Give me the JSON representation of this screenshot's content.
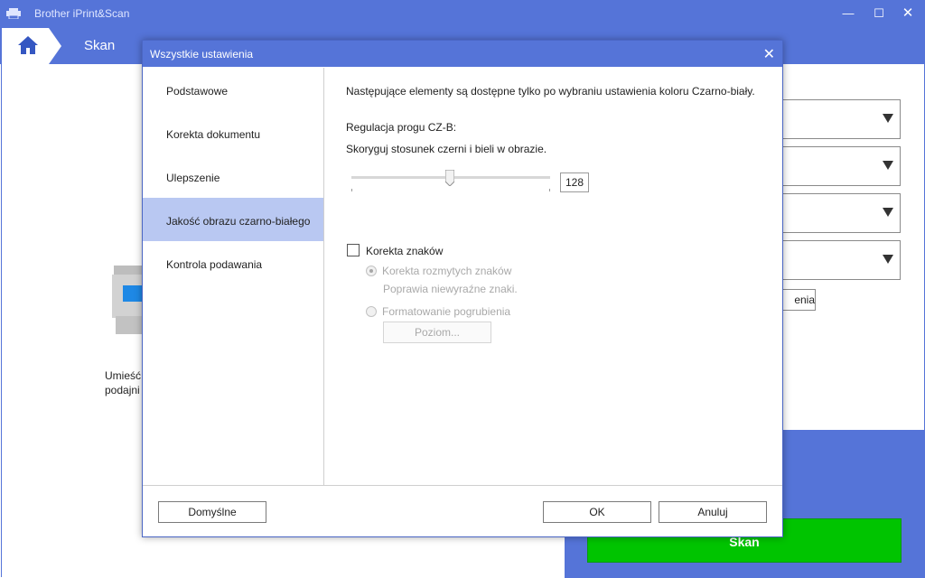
{
  "app": {
    "title": "Brother iPrint&Scan",
    "nav_title": "Skan"
  },
  "background": {
    "hint_line1": "Umieść",
    "hint_line2": "podajni",
    "settings_button_partial": "enia",
    "scan_button": "Skan"
  },
  "dialog": {
    "title": "Wszystkie ustawienia",
    "nav_items": [
      {
        "label": "Podstawowe"
      },
      {
        "label": "Korekta dokumentu"
      },
      {
        "label": "Ulepszenie"
      },
      {
        "label": "Jakość obrazu czarno-białego"
      },
      {
        "label": "Kontrola podawania"
      }
    ],
    "active_nav_index": 3,
    "note": "Następujące elementy są dostępne tylko po wybraniu ustawienia koloru Czarno-biały.",
    "threshold": {
      "label": "Regulacja progu CZ-B:",
      "description": "Skoryguj stosunek czerni i bieli w obrazie.",
      "value": "128",
      "min": 0,
      "max": 255
    },
    "char_correction": {
      "label": "Korekta znaków",
      "checked": false,
      "options": [
        {
          "label": "Korekta rozmytych znaków",
          "description": "Poprawia niewyraźne znaki.",
          "selected": true
        },
        {
          "label": "Formatowanie pogrubienia",
          "selected": false
        }
      ],
      "level_button": "Poziom..."
    },
    "footer": {
      "default_button": "Domyślne",
      "ok_button": "OK",
      "cancel_button": "Anuluj"
    }
  },
  "colors": {
    "accent": "#5574d8",
    "active_nav": "#b9c8f2",
    "scan_green": "#00c400"
  }
}
